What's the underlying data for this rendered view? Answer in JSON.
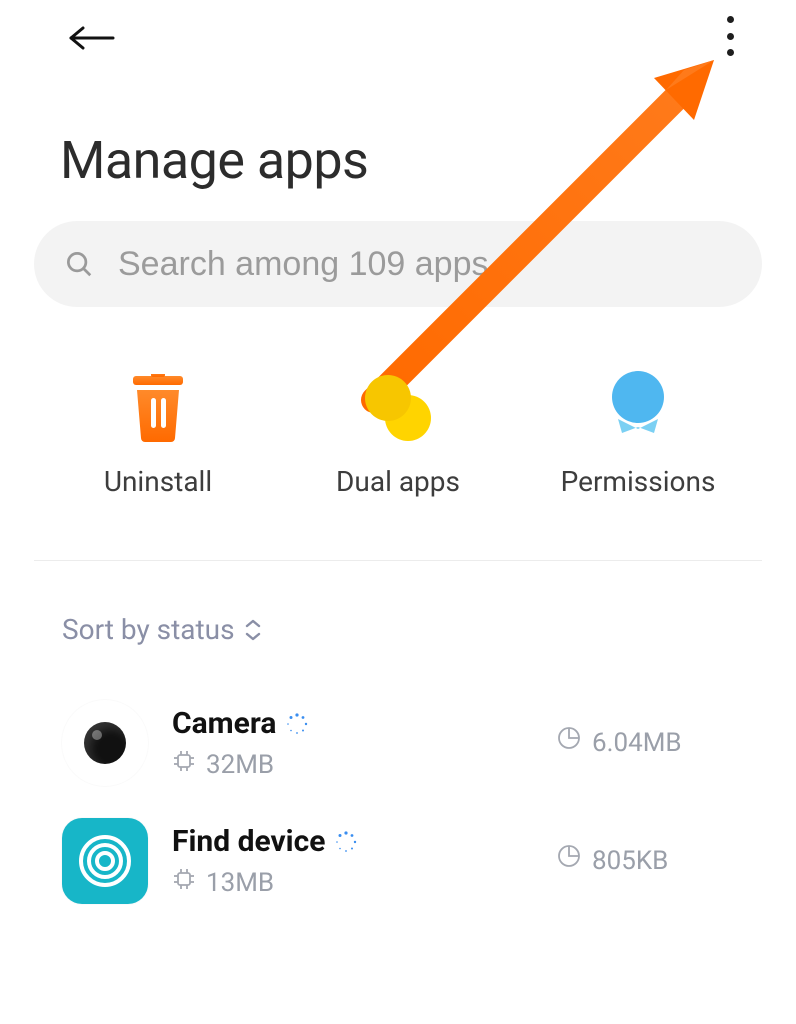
{
  "header": {
    "title": "Manage apps"
  },
  "search": {
    "placeholder": "Search among 109 apps"
  },
  "actions": {
    "uninstall": {
      "label": "Uninstall"
    },
    "dual": {
      "label": "Dual apps"
    },
    "permissions": {
      "label": "Permissions"
    }
  },
  "sort": {
    "label": "Sort by status"
  },
  "apps": [
    {
      "name": "Camera",
      "storage": "32MB",
      "data": "6.04MB"
    },
    {
      "name": "Find device",
      "storage": "13MB",
      "data": "805KB"
    }
  ],
  "colors": {
    "accent_orange": "#ff7a1a",
    "yellow": "#f8c500",
    "blue": "#4fb7f0",
    "teal": "#17b6c8"
  }
}
